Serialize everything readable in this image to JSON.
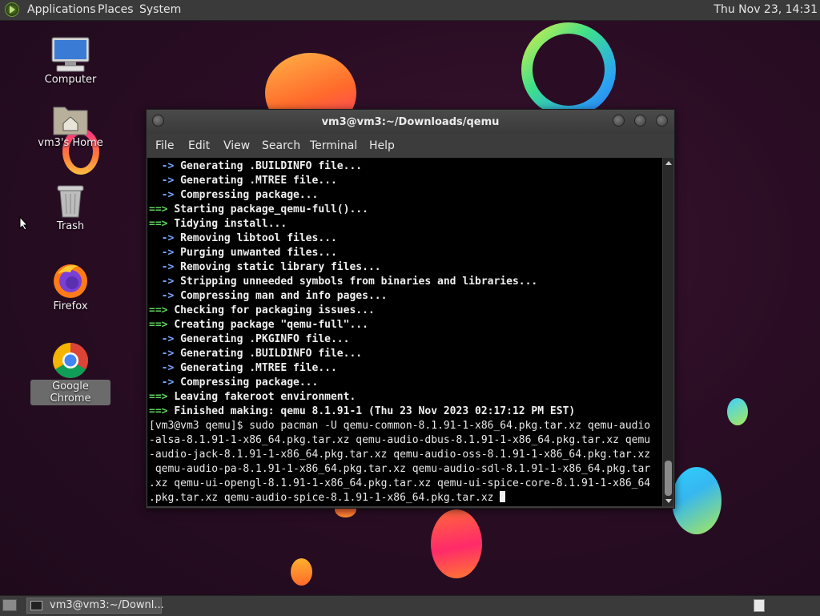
{
  "top_panel": {
    "menus": [
      "Applications",
      "Places",
      "System"
    ],
    "clock": "Thu Nov 23, 14:31"
  },
  "desktop_icons": [
    {
      "label": "Computer",
      "icon": "computer-icon"
    },
    {
      "label": "vm3's Home",
      "icon": "home-folder-icon"
    },
    {
      "label": "Trash",
      "icon": "trash-icon"
    },
    {
      "label": "Firefox",
      "icon": "firefox-icon"
    },
    {
      "label": "Google Chrome",
      "icon": "chrome-icon"
    }
  ],
  "terminal": {
    "title": "vm3@vm3:~/Downloads/qemu",
    "menu": [
      "File",
      "Edit",
      "View",
      "Search",
      "Terminal",
      "Help"
    ],
    "lines": [
      {
        "p": "  -> ",
        "t": "Generating .BUILDINFO file..."
      },
      {
        "p": "  -> ",
        "t": "Generating .MTREE file..."
      },
      {
        "p": "  -> ",
        "t": "Compressing package..."
      },
      {
        "p": "==> ",
        "t": "Starting package_qemu-full()..."
      },
      {
        "p": "==> ",
        "t": "Tidying install..."
      },
      {
        "p": "  -> ",
        "t": "Removing libtool files..."
      },
      {
        "p": "  -> ",
        "t": "Purging unwanted files..."
      },
      {
        "p": "  -> ",
        "t": "Removing static library files..."
      },
      {
        "p": "  -> ",
        "t": "Stripping unneeded symbols from binaries and libraries..."
      },
      {
        "p": "  -> ",
        "t": "Compressing man and info pages..."
      },
      {
        "p": "==> ",
        "t": "Checking for packaging issues..."
      },
      {
        "p": "==> ",
        "t": "Creating package \"qemu-full\"..."
      },
      {
        "p": "  -> ",
        "t": "Generating .PKGINFO file..."
      },
      {
        "p": "  -> ",
        "t": "Generating .BUILDINFO file..."
      },
      {
        "p": "  -> ",
        "t": "Generating .MTREE file..."
      },
      {
        "p": "  -> ",
        "t": "Compressing package..."
      },
      {
        "p": "==> ",
        "t": "Leaving fakeroot environment."
      },
      {
        "p": "==> ",
        "t": "Finished making: qemu 8.1.91-1 (Thu 23 Nov 2023 02:17:12 PM EST)"
      }
    ],
    "command_lines": [
      "[vm3@vm3 qemu]$ sudo pacman -U qemu-common-8.1.91-1-x86_64.pkg.tar.xz qemu-audio",
      "-alsa-8.1.91-1-x86_64.pkg.tar.xz qemu-audio-dbus-8.1.91-1-x86_64.pkg.tar.xz qemu",
      "-audio-jack-8.1.91-1-x86_64.pkg.tar.xz qemu-audio-oss-8.1.91-1-x86_64.pkg.tar.xz",
      " qemu-audio-pa-8.1.91-1-x86_64.pkg.tar.xz qemu-audio-sdl-8.1.91-1-x86_64.pkg.tar",
      ".xz qemu-ui-opengl-8.1.91-1-x86_64.pkg.tar.xz qemu-ui-spice-core-8.1.91-1-x86_64",
      ".pkg.tar.xz qemu-audio-spice-8.1.91-1-x86_64.pkg.tar.xz "
    ]
  },
  "bottom_panel": {
    "task_label": "vm3@vm3:~/Downl..."
  }
}
